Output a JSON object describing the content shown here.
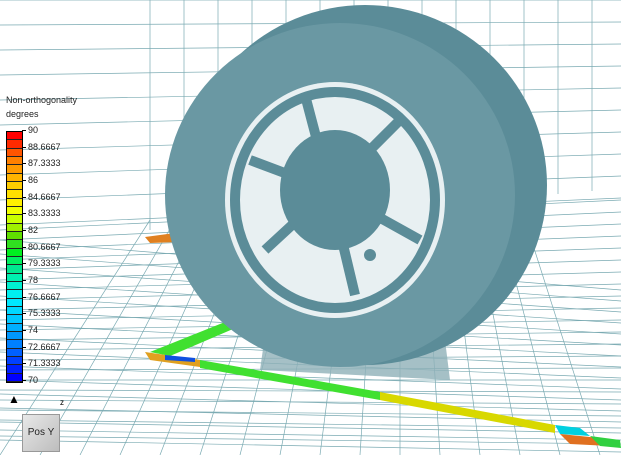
{
  "legend": {
    "title": "Non-orthogonality",
    "units": "degrees",
    "labels": [
      "90",
      "88.6667",
      "87.3333",
      "86",
      "84.6667",
      "83.3333",
      "82",
      "80.6667",
      "79.3333",
      "78",
      "76.6667",
      "75.3333",
      "74",
      "72.6667",
      "71.3333",
      "70"
    ],
    "colors": [
      "#ff0000",
      "#ff2a00",
      "#ff5500",
      "#ff8000",
      "#ff9a00",
      "#ffb400",
      "#ffcc00",
      "#ffe000",
      "#fff000",
      "#f0ff00",
      "#c8ff00",
      "#a0f000",
      "#60e000",
      "#30e020",
      "#00f020",
      "#00f060",
      "#00e890",
      "#00f0b0",
      "#00f0d0",
      "#00f0f0",
      "#00e8ff",
      "#00d8ff",
      "#00c8ff",
      "#00b0ff",
      "#0098ff",
      "#0080ff",
      "#0060ff",
      "#0040ff",
      "#0020ff",
      "#0000ff"
    ]
  },
  "navigation": {
    "cube_label": "Pos Y",
    "axis_label": "z",
    "home_icon": "home-icon"
  },
  "colors": {
    "mesh": "#5b8c98",
    "grid": "#6aa0aa"
  }
}
